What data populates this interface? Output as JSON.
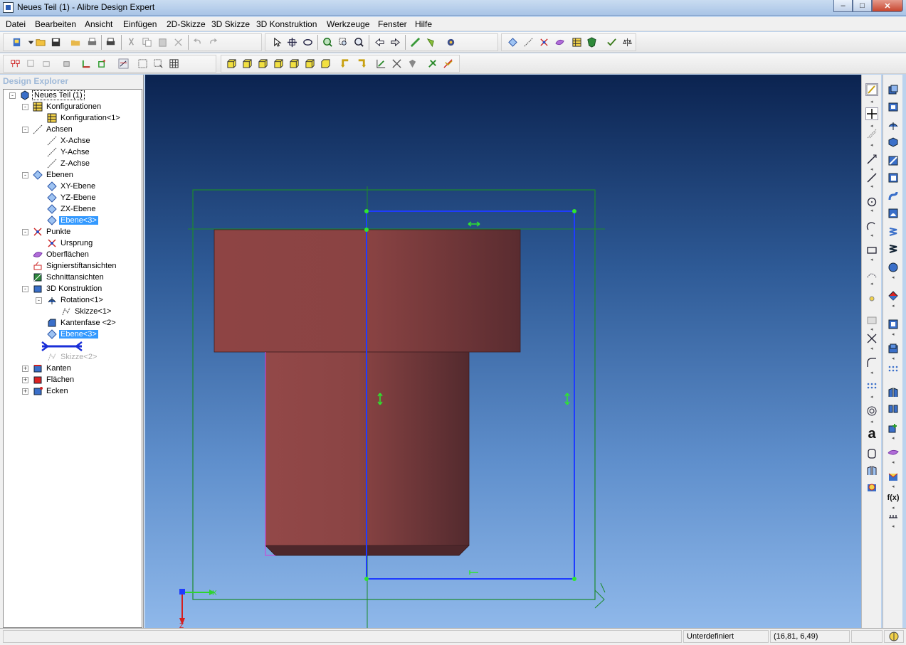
{
  "window": {
    "title": "Neues Teil (1) - Alibre Design Expert"
  },
  "menu": [
    "Datei",
    "Bearbeiten",
    "Ansicht",
    "Einfügen",
    "2D-Skizze",
    "3D Skizze",
    "3D Konstruktion",
    "Werkzeuge",
    "Fenster",
    "Hilfe"
  ],
  "explorer": {
    "title": "Design Explorer",
    "tree": [
      {
        "label": "Neues Teil (1)",
        "icon": "part-icon"
      },
      {
        "label": "Konfigurationen",
        "icon": "config-icon"
      },
      {
        "label": "Konfiguration<1>",
        "icon": "config-icon"
      },
      {
        "label": "Achsen",
        "icon": "axis-icon"
      },
      {
        "label": "X-Achse",
        "icon": "axis-icon"
      },
      {
        "label": "Y-Achse",
        "icon": "axis-icon"
      },
      {
        "label": "Z-Achse",
        "icon": "axis-icon"
      },
      {
        "label": "Ebenen",
        "icon": "plane-icon"
      },
      {
        "label": "XY-Ebene",
        "icon": "plane-icon"
      },
      {
        "label": "YZ-Ebene",
        "icon": "plane-icon"
      },
      {
        "label": "ZX-Ebene",
        "icon": "plane-icon"
      },
      {
        "label": "Ebene<3>",
        "icon": "plane-icon"
      },
      {
        "label": "Punkte",
        "icon": "point-icon"
      },
      {
        "label": "Ursprung",
        "icon": "point-icon"
      },
      {
        "label": "Oberflächen",
        "icon": "surface-icon"
      },
      {
        "label": "Signierstiftansichten",
        "icon": "pen-icon"
      },
      {
        "label": "Schnittansichten",
        "icon": "section-icon"
      },
      {
        "label": "3D Konstruktion",
        "icon": "feature-icon"
      },
      {
        "label": "Rotation<1>",
        "icon": "revolve-icon"
      },
      {
        "label": "Skizze<1>",
        "icon": "sketch-icon"
      },
      {
        "label": "Kantenfase <2>",
        "icon": "chamfer-icon"
      },
      {
        "label": "Ebene<3>",
        "icon": "plane-icon"
      },
      {
        "label": "Skizze<2>",
        "icon": "sketch-icon"
      },
      {
        "label": "Kanten",
        "icon": "edge-icon"
      },
      {
        "label": "Flächen",
        "icon": "face-icon"
      },
      {
        "label": "Ecken",
        "icon": "vertex-icon"
      }
    ]
  },
  "viewport": {
    "triad_x": "X",
    "triad_z": "Z"
  },
  "status": {
    "state": "Unterdefiniert",
    "coords": "(16,81, 6,49)"
  },
  "colors": {
    "part": "#8e4141",
    "sketch": "#1e3cff",
    "plane": "#1c8a2c",
    "handles": "#2ee62e"
  }
}
